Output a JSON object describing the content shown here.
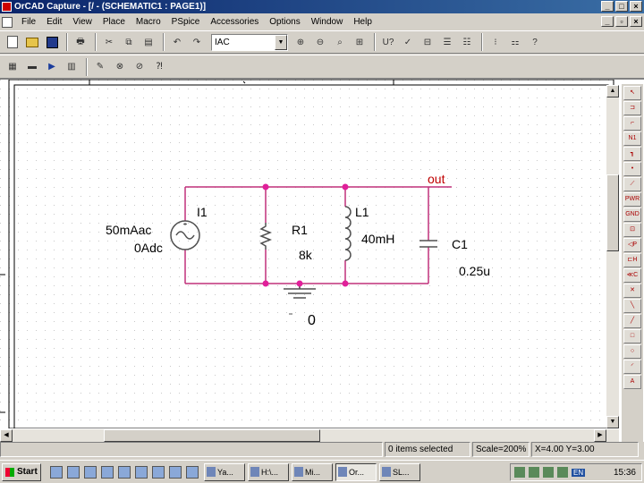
{
  "window": {
    "title": "OrCAD Capture - [/ - (SCHEMATIC1 : PAGE1)]"
  },
  "menu": [
    "File",
    "Edit",
    "View",
    "Place",
    "Macro",
    "PSpice",
    "Accessories",
    "Options",
    "Window",
    "Help"
  ],
  "toolbar": {
    "part_value": "IAC"
  },
  "schematic": {
    "source": {
      "ref": "I1",
      "ac": "50mAac",
      "dc": "0Adc"
    },
    "resistor": {
      "ref": "R1",
      "value": "8k"
    },
    "inductor": {
      "ref": "L1",
      "value": "40mH"
    },
    "capacitor": {
      "ref": "C1",
      "value": "0.25u"
    },
    "net_label": "out",
    "ground": "0",
    "colors": {
      "wire": "#c0307a",
      "junction": "#e0209a",
      "part": "#505050",
      "label": "#000000",
      "net_label": "#c00000",
      "grid": "#c8c8c8"
    }
  },
  "palette": [
    "select-arrow",
    "part",
    "wire",
    "net-alias",
    "bus",
    "junction",
    "bus-entry",
    "power",
    "ground",
    "hierarchical-block",
    "hierarchical-port",
    "hierarchical-pin",
    "off-page-connector",
    "no-connect",
    "line",
    "polyline",
    "rectangle",
    "ellipse",
    "arc",
    "text"
  ],
  "status": {
    "selection": "0 items selected",
    "scale": "Scale=200%",
    "coords": "X=4.00  Y=3.00"
  },
  "taskbar": {
    "start": "Start",
    "tasks": [
      {
        "label": "Ya...",
        "active": false
      },
      {
        "label": "H:\\...",
        "active": false
      },
      {
        "label": "Mi...",
        "active": false
      },
      {
        "label": "Or...",
        "active": true
      },
      {
        "label": "SL...",
        "active": false
      }
    ],
    "lang": "EN",
    "clock": "15:36"
  }
}
